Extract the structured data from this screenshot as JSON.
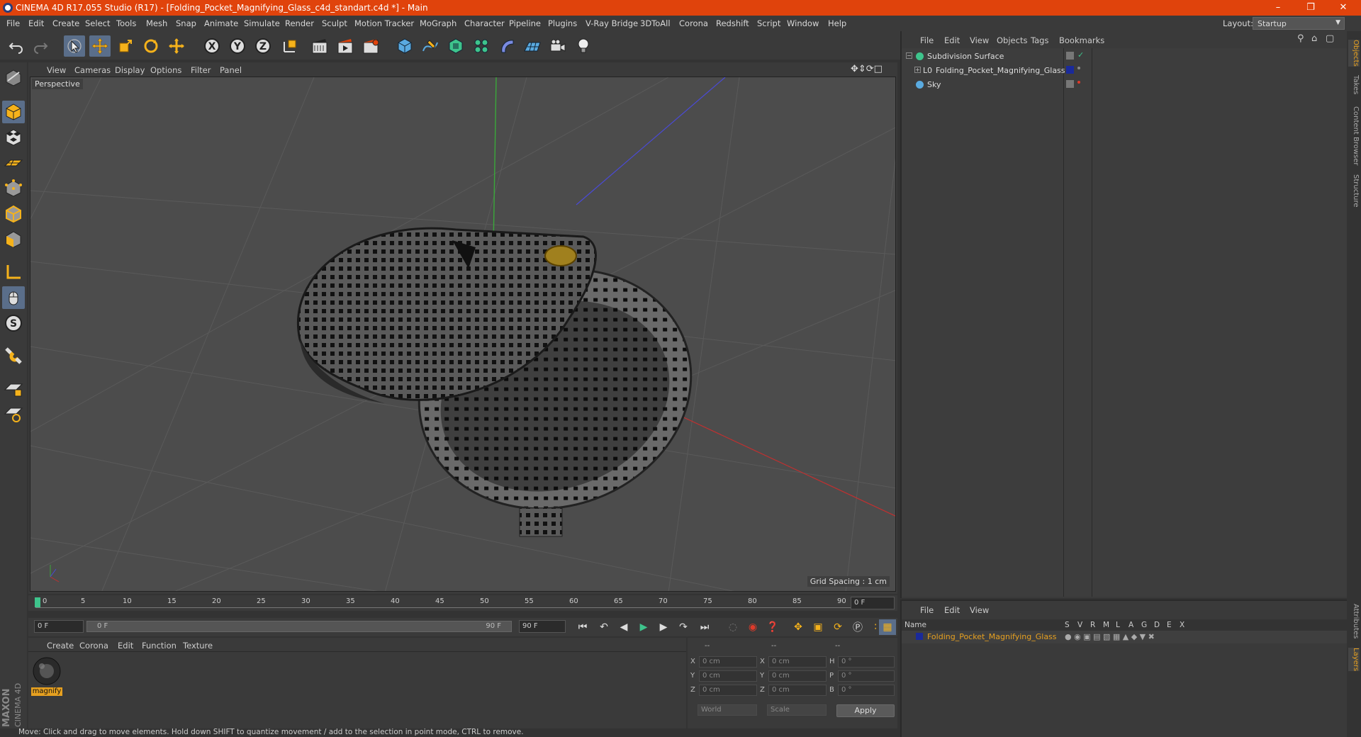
{
  "title": "CINEMA 4D R17.055 Studio (R17) - [Folding_Pocket_Magnifying_Glass_c4d_standart.c4d *] - Main",
  "menu": [
    "File",
    "Edit",
    "Create",
    "Select",
    "Tools",
    "Mesh",
    "Snap",
    "Animate",
    "Simulate",
    "Render",
    "Sculpt",
    "Motion Tracker",
    "MoGraph",
    "Character",
    "Pipeline",
    "Plugins",
    "V-Ray Bridge",
    "3DToAll",
    "Corona",
    "Redshift",
    "Script",
    "Window",
    "Help"
  ],
  "layout": {
    "label": "Layout:",
    "value": "Startup"
  },
  "viewport": {
    "menu": [
      "View",
      "Cameras",
      "Display",
      "Options",
      "Filter",
      "Panel"
    ],
    "label": "Perspective",
    "grid_spacing": "Grid Spacing : 1 cm"
  },
  "timeline": {
    "ticks": [
      "0",
      "5",
      "10",
      "15",
      "20",
      "25",
      "30",
      "35",
      "40",
      "45",
      "50",
      "55",
      "60",
      "65",
      "70",
      "75",
      "80",
      "85",
      "90"
    ],
    "current": "0 F",
    "start": "0 F",
    "range_start": "0 F",
    "range_end": "90 F",
    "end": "90 F"
  },
  "materials": {
    "menu": [
      "Create",
      "Corona",
      "Edit",
      "Function",
      "Texture"
    ],
    "items": [
      {
        "name": "magnify"
      }
    ]
  },
  "coords": {
    "headers": [
      "--",
      "--",
      "--"
    ],
    "rows": [
      {
        "a": "X",
        "av": "0 cm",
        "b": "X",
        "bv": "0 cm",
        "c": "H",
        "cv": "0 °"
      },
      {
        "a": "Y",
        "av": "0 cm",
        "b": "Y",
        "bv": "0 cm",
        "c": "P",
        "cv": "0 °"
      },
      {
        "a": "Z",
        "av": "0 cm",
        "b": "Z",
        "bv": "0 cm",
        "c": "B",
        "cv": "0 °"
      }
    ],
    "world": "World",
    "scale": "Scale",
    "apply": "Apply"
  },
  "objects": {
    "menu": [
      "File",
      "Edit",
      "View",
      "Objects",
      "Tags",
      "Bookmarks"
    ],
    "items": [
      {
        "name": "Subdivision Surface"
      },
      {
        "name": "Folding_Pocket_Magnifying_Glass"
      },
      {
        "name": "Sky"
      }
    ]
  },
  "layers": {
    "menu": [
      "File",
      "Edit",
      "View"
    ],
    "columns": [
      "Name",
      "S",
      "V",
      "R",
      "M",
      "L",
      "A",
      "G",
      "D",
      "E",
      "X"
    ],
    "items": [
      {
        "name": "Folding_Pocket_Magnifying_Glass",
        "color": "#e6a020"
      }
    ]
  },
  "side_tabs": [
    "Objects",
    "Takes",
    "Content Browser",
    "Structure"
  ],
  "side_tabs_bottom": [
    "Attributes",
    "Layers"
  ],
  "status": "Move: Click and drag to move elements. Hold down SHIFT to quantize movement / add to the selection in point mode, CTRL to remove.",
  "brand": {
    "line1": "MAXON",
    "line2": "CINEMA 4D"
  }
}
